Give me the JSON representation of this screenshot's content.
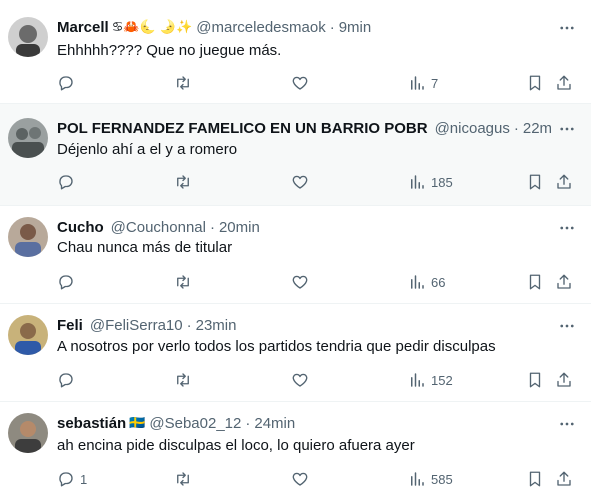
{
  "colors": {
    "text": "#0f1419",
    "secondary": "#536471",
    "divider": "#eff3f4",
    "hover_bg": "#f7f9f9"
  },
  "icons": {
    "reply": "reply-icon",
    "retweet": "retweet-icon",
    "like": "like-icon",
    "views": "views-icon",
    "bookmark": "bookmark-icon",
    "share": "share-icon",
    "more": "more-icon"
  },
  "tweets": [
    {
      "name": "Marcell",
      "emoji": "♋🦀🌜 🌛✨",
      "handle": "@marceledesmaok",
      "dot": "·",
      "time": "9min",
      "text": "Ehhhhh????  Que no juegue más.",
      "replies": "",
      "views": "7"
    },
    {
      "name": "POL FERNANDEZ FAMELICO EN UN BARRIO POBR",
      "emoji": "",
      "handle": "@nicoagus",
      "dot": "·",
      "time": "22min",
      "text": "Déjenlo ahí a el y a romero",
      "replies": "",
      "views": "185"
    },
    {
      "name": "Cucho",
      "emoji": "",
      "handle": "@Couchonnal",
      "dot": "·",
      "time": "20min",
      "text": "Chau nunca más de titular",
      "replies": "",
      "views": "66"
    },
    {
      "name": "Feli",
      "emoji": "",
      "handle": "@FeliSerra10",
      "dot": "·",
      "time": "23min",
      "text": "A nosotros por verlo todos los partidos tendria que pedir disculpas",
      "replies": "",
      "views": "152"
    },
    {
      "name": "sebastián",
      "emoji": "🇸🇪",
      "handle": "@Seba02_12",
      "dot": "·",
      "time": "24min",
      "text": "ah encina pide disculpas el loco, lo quiero afuera ayer",
      "replies": "1",
      "views": "585"
    }
  ]
}
